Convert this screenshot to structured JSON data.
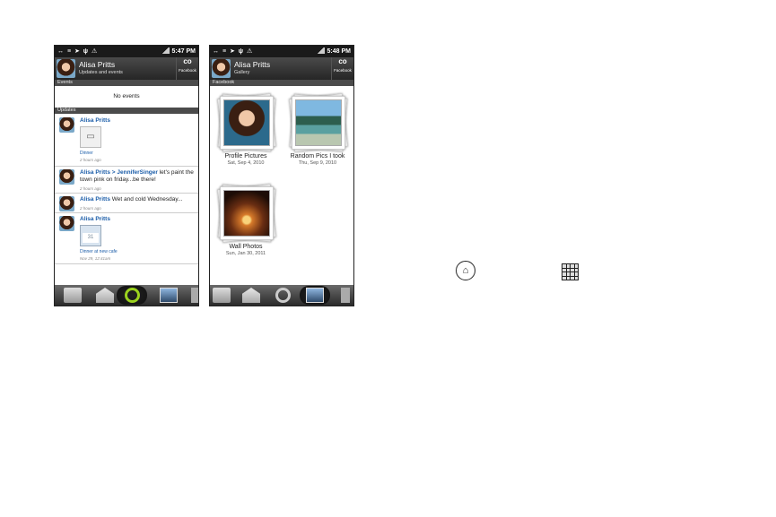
{
  "phone1": {
    "status": {
      "time": "5:47 PM"
    },
    "header": {
      "name": "Alisa Pritts",
      "subtitle": "Updates and events",
      "button_label": "Facebook"
    },
    "events_title": "Events",
    "no_events": "No events",
    "updates_title": "Updates",
    "updates": [
      {
        "name": "Alisa Pritts",
        "caption": "Dinner",
        "time": "2 hours ago"
      },
      {
        "name": "Alisa Pritts",
        "arrow": ">",
        "target": "JenniferSinger",
        "text": " let's paint the town pink on friday...be there!",
        "time": "2 hours ago"
      },
      {
        "name": "Alisa Pritts",
        "text": " Wet and cold Wednesday...",
        "time": "2 hours ago"
      },
      {
        "name": "Alisa Pritts",
        "thumb_text": "31",
        "caption": "Dinner at new cafe",
        "time": "Nov 29, 12:41am"
      }
    ]
  },
  "phone2": {
    "status": {
      "time": "5:48 PM"
    },
    "header": {
      "name": "Alisa Pritts",
      "subtitle": "Gallery",
      "button_label": "Facebook"
    },
    "section_title": "Facebook",
    "albums": [
      {
        "title": "Profile Pictures",
        "date": "Sat, Sep 4, 2010"
      },
      {
        "title": "Random Pics I took",
        "date": "Thu, Sep 9, 2010"
      },
      {
        "title": "Wall Photos",
        "date": "Sun, Jan 30, 2011"
      }
    ]
  },
  "icons": {
    "home": "home-icon",
    "apps": "all-apps-icon"
  }
}
